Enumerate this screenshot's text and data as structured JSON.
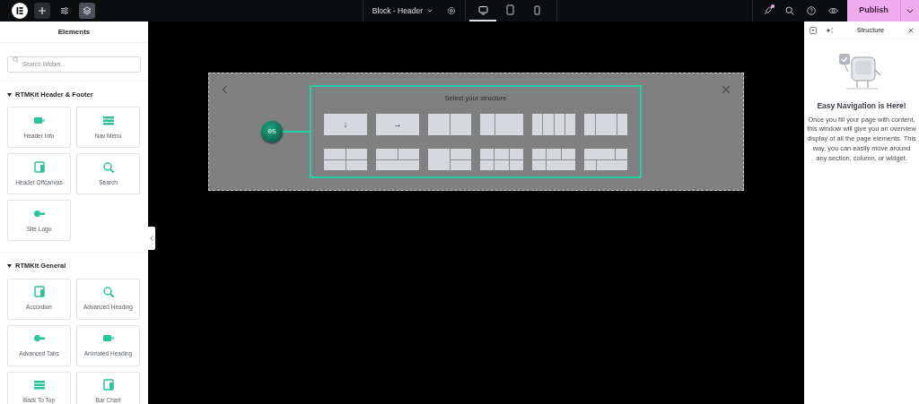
{
  "toolbar": {
    "buttons": [
      {
        "kind": "add",
        "selected": false
      },
      {
        "kind": "settings",
        "selected": false
      },
      {
        "kind": "layers",
        "selected": true
      }
    ]
  },
  "document": {
    "title": "Block - Header"
  },
  "devices": [
    {
      "kind": "desktop",
      "selected": true
    },
    {
      "kind": "tablet",
      "selected": false
    },
    {
      "kind": "mobile",
      "selected": false
    }
  ],
  "actions": {
    "notification": true,
    "publish": "Publish"
  },
  "elements_panel": {
    "title": "Elements",
    "search": {
      "placeholder": "Search Widget..."
    },
    "categories": [
      {
        "name": "RTMKit Header & Footer",
        "expanded": true,
        "widgets": [
          "Header Info",
          "Nav Menu",
          "Header Offcanvas",
          "Search",
          "Site Logo"
        ]
      },
      {
        "name": "RTMKit General",
        "expanded": true,
        "widgets": [
          "Accordion",
          "Advanced Heading",
          "Advanced Tabs",
          "Animated Heading",
          "Back To Top",
          "Bar Chart"
        ]
      }
    ]
  },
  "canvas": {
    "title": "Select your structure",
    "step": "05",
    "structures": [
      {
        "kind": "flex-column",
        "glyph": "↓"
      },
      {
        "kind": "flex-row",
        "glyph": "→"
      },
      {
        "kind": "halves"
      },
      {
        "kind": "third-twothirds"
      },
      {
        "kind": "quarters"
      },
      {
        "kind": "quarter-half-quarter"
      },
      {
        "kind": "grid-2x2"
      },
      {
        "kind": "two-over-one"
      },
      {
        "kind": "tall-left"
      },
      {
        "kind": "grid-3x2"
      },
      {
        "kind": "three-over-split"
      },
      {
        "kind": "split-over-split"
      }
    ]
  },
  "structure_panel": {
    "title": "Structure",
    "heading": "Easy Navigation is Here!",
    "text": "Once you fill your page with content, this window will give you an overview display of all the page elements. This way, you can easily move around any section, column, or widget."
  }
}
